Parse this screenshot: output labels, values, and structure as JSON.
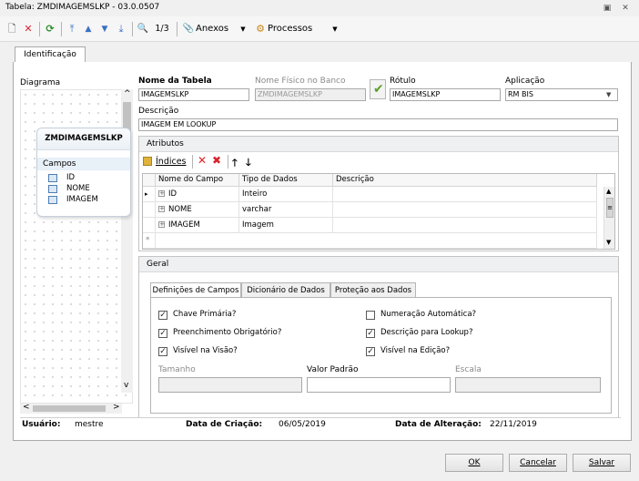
{
  "window": {
    "title": "Tabela: ZMDIMAGEMSLKP - 03.0.0507",
    "restore_glyph": "▣",
    "close_glyph": "✕"
  },
  "toolbar": {
    "record_position": "1/3",
    "anexos_label": "Anexos",
    "processos_label": "Processos",
    "icons": [
      "new-document-icon",
      "delete-icon",
      "refresh-icon",
      "first-record-icon",
      "previous-record-icon",
      "next-record-icon",
      "last-record-icon",
      "binoculars-icon",
      "attachment-icon",
      "processes-icon"
    ],
    "glyphs": {
      "new": "🗋",
      "delete": "✕",
      "refresh": "⟳",
      "first": "⤒",
      "prev": "▲",
      "next": "▼",
      "last": "⤓",
      "find": "🔍",
      "attach": "📎",
      "process": "⚙",
      "dropdown": "▼"
    }
  },
  "tabs": {
    "identificacao": "Identificação"
  },
  "diagram": {
    "label": "Diagrama",
    "entity_name": "ZMDIMAGEMSLKP",
    "section_label": "Campos",
    "fields": [
      "ID",
      "NOME",
      "IMAGEM"
    ],
    "scroll_glyphs": {
      "up": "^",
      "down": "v",
      "left": "<",
      "right": ">"
    }
  },
  "form": {
    "nome_tabela_label": "Nome da Tabela",
    "nome_tabela_value": "IMAGEMSLKP",
    "nome_fisico_label": "Nome Físico no Banco",
    "nome_fisico_value": "ZMDIMAGEMSLKP",
    "rotulo_label": "Rótulo",
    "rotulo_value": "IMAGEMSLKP",
    "aplicacao_label": "Aplicação",
    "aplicacao_value": "RM BIS",
    "descricao_label": "Descrição",
    "descricao_value": "IMAGEM EM LOOKUP",
    "check_glyph": "✔",
    "dropdown_glyph": "▼"
  },
  "atributos": {
    "title": "Atributos",
    "indices_label": "Índices",
    "tool_glyphs": {
      "delete": "✕",
      "delete_all": "✖",
      "up": "🡑",
      "down": "🡓"
    },
    "columns": [
      "Nome do Campo",
      "Tipo de Dados",
      "Descrição"
    ],
    "rows": [
      {
        "name": "ID",
        "type": "Inteiro",
        "desc": ""
      },
      {
        "name": "NOME",
        "type": "varchar",
        "desc": ""
      },
      {
        "name": "IMAGEM",
        "type": "Imagem",
        "desc": ""
      }
    ],
    "row_pointer": "▸",
    "new_row_marker": "*",
    "expand_glyph": "+",
    "scroll_glyphs": {
      "up": "▲",
      "down": "▼",
      "grip": "≡"
    }
  },
  "geral": {
    "title": "Geral",
    "subtabs": [
      "Definições de Campos",
      "Dicionário de Dados",
      "Proteção aos Dados"
    ],
    "checkboxes": [
      {
        "label": "Chave Primária?",
        "checked": true
      },
      {
        "label": "Numeração Automática?",
        "checked": false
      },
      {
        "label": "Preenchimento Obrigatório?",
        "checked": true
      },
      {
        "label": "Descrição para Lookup?",
        "checked": true
      },
      {
        "label": "Visível na Visão?",
        "checked": true
      },
      {
        "label": "Visível na Edição?",
        "checked": true
      }
    ],
    "check_glyph": "✓",
    "tamanho_label": "Tamanho",
    "valor_padrao_label": "Valor Padrão",
    "escala_label": "Escala"
  },
  "footer": {
    "usuario_label": "Usuário:",
    "usuario_value": "mestre",
    "criacao_label": "Data de Criação:",
    "criacao_value": "06/05/2019",
    "alteracao_label": "Data de Alteração:",
    "alteracao_value": "22/11/2019"
  },
  "buttons": {
    "ok": "OK",
    "cancelar": "Cancelar",
    "salvar": "Salvar"
  },
  "colors": {
    "delete_red": "#d9232e",
    "refresh_green": "#2e8b2e",
    "nav_blue": "#3a6fc4",
    "check_green": "#5aa02c"
  }
}
